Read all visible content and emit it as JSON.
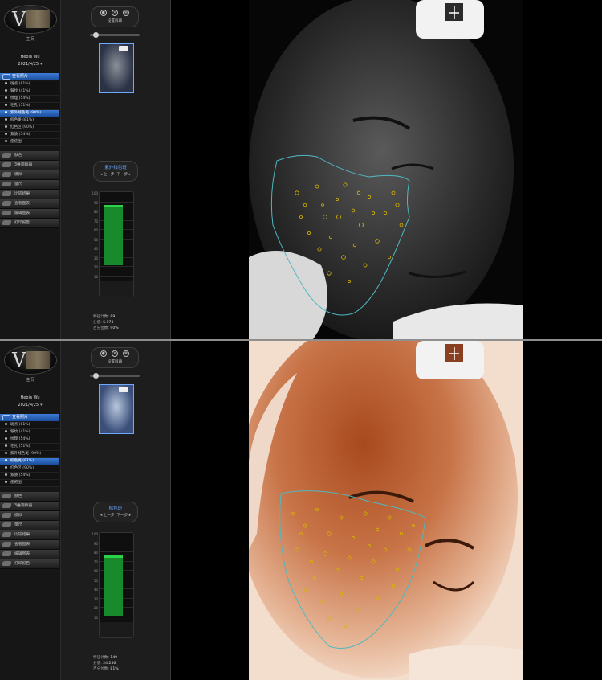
{
  "sidebar": {
    "home": "主页",
    "user_name": "Hebin Wu",
    "date": "2021/4/25",
    "section_label": "查看照片",
    "nav_items": [
      {
        "label": "肤色"
      },
      {
        "label": "3维观察器"
      },
      {
        "label": "模拟"
      },
      {
        "label": "量尺"
      },
      {
        "label": "比较结果"
      },
      {
        "label": "查看图表"
      },
      {
        "label": "编辑图表"
      },
      {
        "label": "打印报告"
      }
    ]
  },
  "panels": [
    {
      "sub_items": [
        {
          "label": "斑点 (81%)"
        },
        {
          "label": "皱纹 (41%)"
        },
        {
          "label": "纹理 (54%)"
        },
        {
          "label": "毛孔 (51%)"
        },
        {
          "label": "紫外线色斑 (90%)"
        },
        {
          "label": "棕色斑 (81%)"
        },
        {
          "label": "红色区 (90%)"
        },
        {
          "label": "紫质 (54%)"
        },
        {
          "label": "痤疮图"
        }
      ],
      "selected": "紫外线色斑 (90%)",
      "toolbar_label": "设置屏幕",
      "nav_title": "紫外线色斑",
      "prev": "上一步",
      "next": "下一步",
      "gauge_percent": 90,
      "stats": {
        "count_label": "特征计数:",
        "count": "89",
        "score_label": "分值:",
        "score": "5.973",
        "pct_label": "百分位数:",
        "pct": "90%"
      },
      "theme": "uv"
    },
    {
      "sub_items": [
        {
          "label": "斑点 (81%)"
        },
        {
          "label": "皱纹 (41%)"
        },
        {
          "label": "纹理 (54%)"
        },
        {
          "label": "毛孔 (51%)"
        },
        {
          "label": "紫外线色斑 (90%)"
        },
        {
          "label": "棕色斑 (81%)"
        },
        {
          "label": "红色区 (90%)"
        },
        {
          "label": "紫质 (54%)"
        },
        {
          "label": "痤疮图"
        }
      ],
      "selected": "棕色斑 (81%)",
      "toolbar_label": "设置屏幕",
      "nav_title": "棕色斑",
      "prev": "上一步",
      "next": "下一步",
      "gauge_percent": 81,
      "stats": {
        "count_label": "特征计数:",
        "count": "149",
        "score_label": "分值:",
        "score": "24.256",
        "pct_label": "百分位数:",
        "pct": "81%"
      },
      "theme": "brown"
    }
  ],
  "gauge_ticks": [
    "100",
    "90",
    "80",
    "70",
    "60",
    "50",
    "40",
    "30",
    "20",
    "10"
  ],
  "colors": {
    "accent": "#3d7bd6",
    "gauge_fill": "#198a2b",
    "gauge_cap": "#2bd24a",
    "spot_outline": "#d8b400",
    "region_outline": "#4fb8c0"
  },
  "icons": [
    "logo",
    "home-icon",
    "face-icon",
    "target-icon",
    "settings-icon"
  ]
}
